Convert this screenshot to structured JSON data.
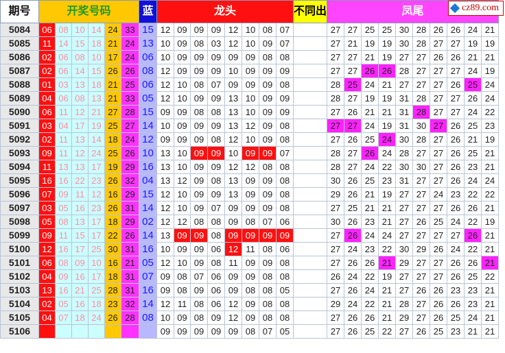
{
  "logo": "cz89.com",
  "headers": {
    "period": "期号",
    "draw": "开奖号码",
    "blue": "蓝",
    "head": "龙头",
    "diff": "不同出",
    "tail": "凤尾"
  },
  "rows": [
    {
      "period": "5084",
      "draw": [
        "06",
        "08",
        "10",
        "14",
        "24",
        "33"
      ],
      "blue": "15",
      "head": [
        "12",
        "09",
        "09",
        "09",
        "12",
        "10",
        "08",
        "07"
      ],
      "tail": [
        "27",
        "27",
        "25",
        "25",
        "30",
        "28",
        "26",
        "26",
        "24",
        "21"
      ],
      "head_red": [],
      "tail_mag": []
    },
    {
      "period": "5085",
      "draw": [
        "11",
        "14",
        "15",
        "18",
        "21",
        "24"
      ],
      "blue": "13",
      "head": [
        "10",
        "09",
        "08",
        "03",
        "12",
        "10",
        "09",
        "07"
      ],
      "tail": [
        "27",
        "21",
        "19",
        "19",
        "30",
        "28",
        "27",
        "27",
        "19",
        "19"
      ],
      "head_red": [],
      "tail_mag": []
    },
    {
      "period": "5086",
      "draw": [
        "02",
        "06",
        "08",
        "10",
        "17",
        "24"
      ],
      "blue": "06",
      "head": [
        "10",
        "09",
        "09",
        "09",
        "09",
        "09",
        "08",
        "08"
      ],
      "tail": [
        "27",
        "27",
        "21",
        "19",
        "27",
        "27",
        "26",
        "26",
        "21",
        "21"
      ],
      "head_red": [],
      "tail_mag": []
    },
    {
      "period": "5087",
      "draw": [
        "02",
        "06",
        "14",
        "15",
        "26",
        "26"
      ],
      "blue": "08",
      "head": [
        "12",
        "09",
        "09",
        "09",
        "10",
        "09",
        "09",
        "09"
      ],
      "tail": [
        "27",
        "27",
        "26",
        "26",
        "28",
        "27",
        "27",
        "27",
        "24",
        "19"
      ],
      "head_red": [],
      "tail_mag": [
        2,
        3
      ]
    },
    {
      "period": "5088",
      "draw": [
        "01",
        "03",
        "13",
        "18",
        "21",
        "25"
      ],
      "blue": "06",
      "head": [
        "12",
        "10",
        "08",
        "07",
        "09",
        "09",
        "09",
        "08"
      ],
      "tail": [
        "28",
        "25",
        "24",
        "21",
        "27",
        "27",
        "27",
        "26",
        "25",
        "24"
      ],
      "head_red": [],
      "tail_mag": [
        1,
        8
      ]
    },
    {
      "period": "5089",
      "draw": [
        "04",
        "06",
        "08",
        "13",
        "21",
        "33"
      ],
      "blue": "05",
      "head": [
        "12",
        "10",
        "09",
        "09",
        "13",
        "10",
        "09",
        "09"
      ],
      "tail": [
        "28",
        "27",
        "19",
        "19",
        "31",
        "28",
        "27",
        "27",
        "26",
        "24"
      ],
      "head_red": [],
      "tail_mag": []
    },
    {
      "period": "5090",
      "draw": [
        "06",
        "11",
        "12",
        "21",
        "27",
        "28"
      ],
      "blue": "15",
      "head": [
        "09",
        "09",
        "08",
        "08",
        "13",
        "10",
        "09",
        "09"
      ],
      "tail": [
        "27",
        "26",
        "21",
        "21",
        "31",
        "28",
        "27",
        "27",
        "24",
        "22"
      ],
      "head_red": [],
      "tail_mag": [
        5
      ]
    },
    {
      "period": "5091",
      "draw": [
        "03",
        "04",
        "17",
        "19",
        "25",
        "27"
      ],
      "blue": "14",
      "head": [
        "10",
        "09",
        "09",
        "09",
        "13",
        "12",
        "09",
        "08"
      ],
      "tail": [
        "27",
        "27",
        "24",
        "19",
        "31",
        "30",
        "27",
        "26",
        "25",
        "23"
      ],
      "head_red": [],
      "tail_mag": [
        0,
        1,
        6
      ]
    },
    {
      "period": "5092",
      "draw": [
        "02",
        "11",
        "13",
        "14",
        "18",
        "24"
      ],
      "blue": "12",
      "head": [
        "09",
        "09",
        "09",
        "08",
        "12",
        "10",
        "09",
        "08"
      ],
      "tail": [
        "27",
        "26",
        "25",
        "24",
        "30",
        "28",
        "27",
        "26",
        "21",
        "19"
      ],
      "head_red": [],
      "tail_mag": [
        3
      ]
    },
    {
      "period": "5093",
      "draw": [
        "09",
        "11",
        "12",
        "24",
        "25",
        "26"
      ],
      "blue": "10",
      "head": [
        "13",
        "10",
        "09",
        "09",
        "10",
        "09",
        "09",
        "07"
      ],
      "tail": [
        "28",
        "27",
        "26",
        "24",
        "28",
        "27",
        "27",
        "26",
        "25",
        "21"
      ],
      "head_red": [
        2,
        3,
        5,
        6
      ],
      "tail_mag": [
        2
      ]
    },
    {
      "period": "5094",
      "draw": [
        "11",
        "13",
        "13",
        "17",
        "19",
        "29"
      ],
      "blue": "16",
      "head": [
        "13",
        "10",
        "09",
        "09",
        "12",
        "12",
        "08",
        "08"
      ],
      "tail": [
        "28",
        "27",
        "24",
        "22",
        "30",
        "30",
        "27",
        "26",
        "23",
        "21"
      ],
      "head_red": [],
      "tail_mag": []
    },
    {
      "period": "5095",
      "draw": [
        "16",
        "16",
        "22",
        "23",
        "26",
        "32"
      ],
      "blue": "04",
      "head": [
        "13",
        "12",
        "09",
        "08",
        "13",
        "09",
        "09",
        "08"
      ],
      "tail": [
        "30",
        "26",
        "25",
        "23",
        "31",
        "27",
        "27",
        "26",
        "24",
        "24"
      ],
      "head_red": [],
      "tail_mag": []
    },
    {
      "period": "5096",
      "draw": [
        "07",
        "09",
        "11",
        "12",
        "16",
        "29"
      ],
      "blue": "15",
      "head": [
        "12",
        "10",
        "09",
        "09",
        "13",
        "09",
        "09",
        "08"
      ],
      "tail": [
        "29",
        "26",
        "21",
        "19",
        "27",
        "27",
        "24",
        "23",
        "22",
        "22"
      ],
      "head_red": [],
      "tail_mag": []
    },
    {
      "period": "5097",
      "draw": [
        "03",
        "05",
        "16",
        "23",
        "26",
        "31"
      ],
      "blue": "14",
      "head": [
        "12",
        "10",
        "09",
        "07",
        "09",
        "09",
        "09",
        "08"
      ],
      "tail": [
        "27",
        "25",
        "21",
        "21",
        "27",
        "27",
        "27",
        "26",
        "26",
        "21"
      ],
      "head_red": [],
      "tail_mag": []
    },
    {
      "period": "5098",
      "draw": [
        "05",
        "08",
        "13",
        "17",
        "18",
        "29"
      ],
      "blue": "02",
      "head": [
        "12",
        "12",
        "08",
        "08",
        "09",
        "08",
        "07",
        "06"
      ],
      "tail": [
        "30",
        "26",
        "23",
        "21",
        "27",
        "26",
        "25",
        "24",
        "22",
        "19"
      ],
      "head_red": [],
      "tail_mag": []
    },
    {
      "period": "5099",
      "draw": [
        "09",
        "11",
        "15",
        "17",
        "22",
        "26"
      ],
      "blue": "14",
      "head": [
        "13",
        "09",
        "09",
        "08",
        "09",
        "09",
        "09",
        "09"
      ],
      "tail": [
        "27",
        "26",
        "24",
        "24",
        "27",
        "27",
        "27",
        "27",
        "26",
        "21"
      ],
      "head_red": [
        1,
        2,
        4,
        5,
        6,
        7
      ],
      "tail_mag": [
        1,
        8
      ]
    },
    {
      "period": "5100",
      "draw": [
        "12",
        "16",
        "17",
        "25",
        "30",
        "31"
      ],
      "blue": "16",
      "head": [
        "10",
        "09",
        "09",
        "06",
        "12",
        "11",
        "08",
        "06"
      ],
      "tail": [
        "27",
        "24",
        "23",
        "22",
        "30",
        "29",
        "26",
        "24",
        "22",
        "21"
      ],
      "head_red": [
        4
      ],
      "tail_mag": []
    },
    {
      "period": "5101",
      "draw": [
        "06",
        "08",
        "09",
        "10",
        "16",
        "21"
      ],
      "blue": "05",
      "head": [
        "12",
        "10",
        "09",
        "08",
        "11",
        "09",
        "09",
        "08"
      ],
      "tail": [
        "27",
        "26",
        "26",
        "21",
        "29",
        "27",
        "27",
        "26",
        "26",
        "21"
      ],
      "head_red": [],
      "tail_mag": [
        3,
        9
      ]
    },
    {
      "period": "5102",
      "draw": [
        "04",
        "09",
        "16",
        "17",
        "18",
        "31"
      ],
      "blue": "07",
      "head": [
        "09",
        "08",
        "07",
        "06",
        "09",
        "09",
        "08",
        "08"
      ],
      "tail": [
        "26",
        "24",
        "22",
        "19",
        "27",
        "27",
        "27",
        "26",
        "25",
        "22"
      ],
      "head_red": [],
      "tail_mag": []
    },
    {
      "period": "5103",
      "draw": [
        "13",
        "16",
        "21",
        "25",
        "28",
        "31"
      ],
      "blue": "16",
      "head": [
        "09",
        "08",
        "09",
        "06",
        "09",
        "08",
        "08",
        "05"
      ],
      "tail": [
        "27",
        "26",
        "24",
        "21",
        "27",
        "26",
        "26",
        "23",
        "23",
        "21"
      ],
      "head_red": [],
      "tail_mag": []
    },
    {
      "period": "5104",
      "draw": [
        "02",
        "05",
        "16",
        "18",
        "23",
        "32"
      ],
      "blue": "14",
      "head": [
        "12",
        "11",
        "08",
        "06",
        "12",
        "09",
        "08",
        "08"
      ],
      "tail": [
        "29",
        "24",
        "22",
        "21",
        "28",
        "27",
        "26",
        "26",
        "23",
        "21"
      ],
      "head_red": [],
      "tail_mag": []
    },
    {
      "period": "5105",
      "draw": [
        "04",
        "07",
        "18",
        "24",
        "26",
        "28"
      ],
      "blue": "08",
      "head": [
        "10",
        "09",
        "08",
        "09",
        "12",
        "09",
        "08",
        "08"
      ],
      "tail": [
        "27",
        "26",
        "26",
        "21",
        "29",
        "27",
        "26",
        "25",
        "24",
        "21"
      ],
      "head_red": [],
      "tail_mag": []
    },
    {
      "period": "5106",
      "draw": [
        "",
        "",
        "",
        "",
        "",
        ""
      ],
      "blue": "",
      "head": [
        "09",
        "09",
        "09",
        "09",
        "09",
        "08",
        "07",
        "05"
      ],
      "tail": [
        "27",
        "26",
        "25",
        "22",
        "27",
        "26",
        "25",
        "23",
        "21",
        "21"
      ],
      "head_red": [],
      "tail_mag": []
    }
  ]
}
